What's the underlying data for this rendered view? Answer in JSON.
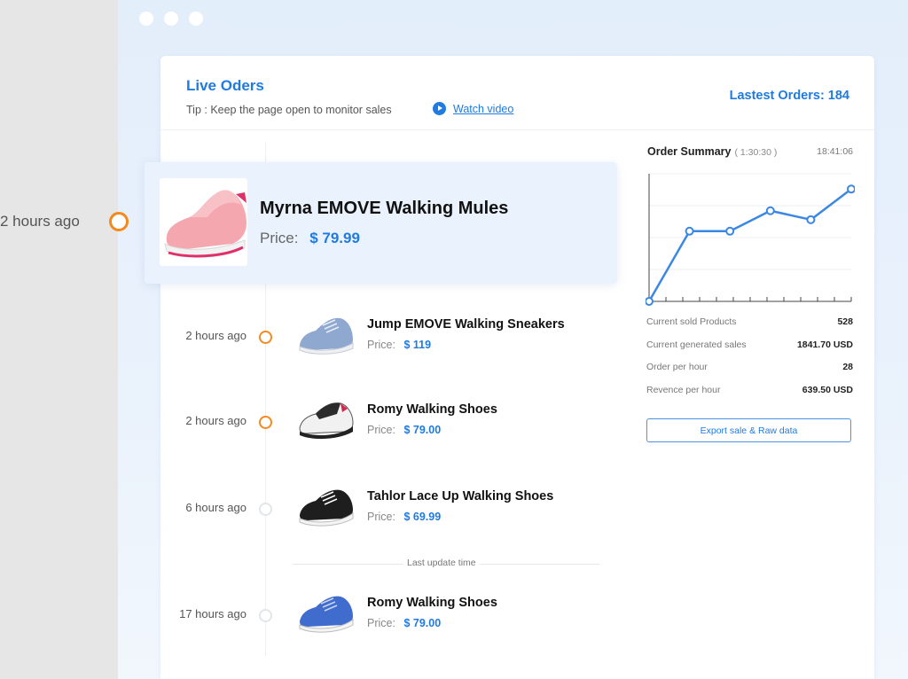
{
  "header": {
    "title": "Live Oders",
    "tip": "Tip : Keep the page open to monitor sales",
    "watch_video": "Watch video",
    "latest_orders": "Lastest Orders: 184"
  },
  "featured": {
    "time": "2 hours ago",
    "name": "Myrna EMOVE Walking Mules",
    "price_label": "Price:",
    "price": "$ 79.99"
  },
  "orders": [
    {
      "time": "2 hours ago",
      "name": "Jump EMOVE Walking Sneakers",
      "price_label": "Price:",
      "price": "$ 119",
      "active": true
    },
    {
      "time": "2 hours ago",
      "name": "Romy Walking Shoes",
      "price_label": "Price:",
      "price": "$ 79.00",
      "active": true
    },
    {
      "time": "6 hours ago",
      "name": "Tahlor Lace Up Walking Shoes",
      "price_label": "Price:",
      "price": "$ 69.99",
      "active": false
    },
    {
      "time": "17 hours ago",
      "name": "Romy Walking Shoes",
      "price_label": "Price:",
      "price": "$ 79.00",
      "active": false
    }
  ],
  "separator": "Last update time",
  "summary": {
    "title": "Order Summary",
    "range": "( 1:30:30 )",
    "time": "18:41:06",
    "stats": [
      {
        "label": "Current sold Products",
        "value": "528"
      },
      {
        "label": "Current generated sales",
        "value": "1841.70 USD"
      },
      {
        "label": "Order per hour",
        "value": "28"
      },
      {
        "label": "Revence per hour",
        "value": "639.50 USD"
      }
    ],
    "export_label": "Export sale & Raw data"
  },
  "chart_data": {
    "type": "line",
    "x": [
      0,
      1,
      2,
      3,
      4,
      5
    ],
    "values": [
      0,
      55,
      55,
      71,
      64,
      88
    ],
    "ylim": [
      0,
      100
    ],
    "grid": true,
    "color": "#3b87e4"
  },
  "colors": {
    "accent": "#1f7be0",
    "active_ring": "#f28a1e",
    "inactive_ring": "#e2e5e9"
  }
}
